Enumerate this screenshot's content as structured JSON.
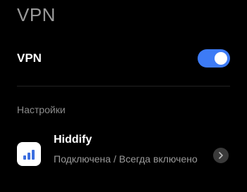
{
  "page": {
    "title": "VPN"
  },
  "vpn": {
    "label": "VPN",
    "enabled": true,
    "toggle_color": "#3d7bf6"
  },
  "settings": {
    "section_label": "Настройки",
    "items": [
      {
        "name": "Hiddify",
        "status": "Подключена / Всегда включено",
        "icon": "hiddify-app-icon",
        "action_icon": "chevron-right-icon"
      }
    ]
  }
}
